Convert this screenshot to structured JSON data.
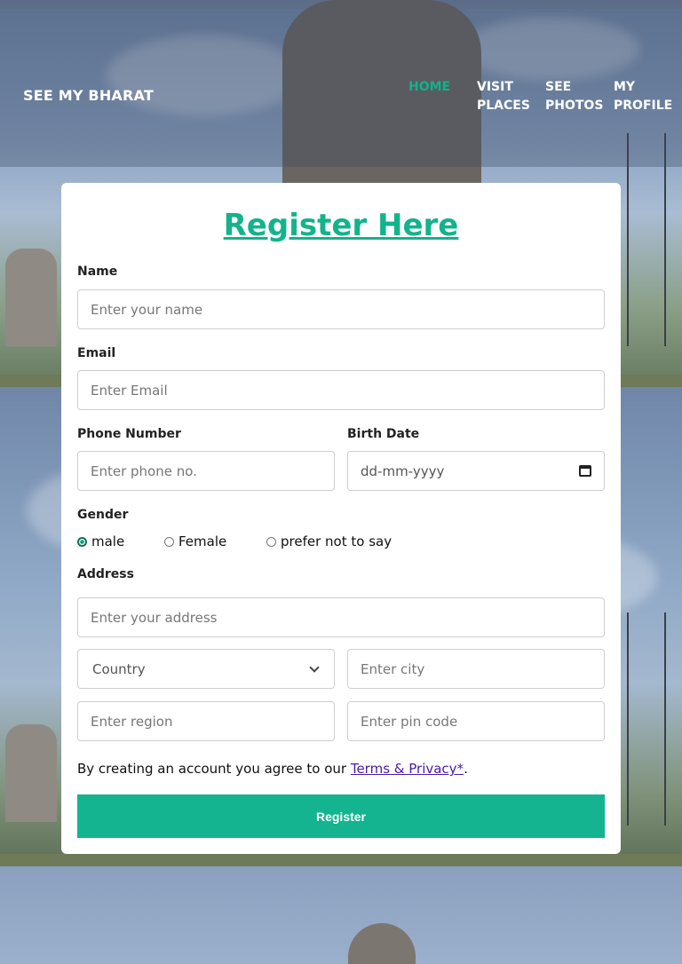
{
  "brand": "SEE MY BHARAT",
  "nav": {
    "items": [
      {
        "label": "HOME"
      },
      {
        "label": "VISIT PLACES"
      },
      {
        "label": "SEE PHOTOS"
      },
      {
        "label": "MY PROFILE"
      }
    ],
    "active_color": "#0fb38a"
  },
  "form": {
    "title": "Register Here",
    "name": {
      "label": "Name",
      "placeholder": "Enter your name"
    },
    "email": {
      "label": "Email",
      "placeholder": "Enter Email"
    },
    "phone": {
      "label": "Phone Number",
      "placeholder": "Enter phone no."
    },
    "birth": {
      "label": "Birth Date",
      "placeholder": "dd-mm-yyyy"
    },
    "gender": {
      "label": "Gender",
      "options": [
        {
          "label": "male",
          "checked": true
        },
        {
          "label": "Female",
          "checked": false
        },
        {
          "label": "prefer not to say",
          "checked": false
        }
      ]
    },
    "address": {
      "label": "Address",
      "placeholder": "Enter your address",
      "country": "Country",
      "city_placeholder": "Enter city",
      "region_placeholder": "Enter region",
      "pin_placeholder": "Enter pin code"
    },
    "terms": {
      "prefix": "By creating an account you agree to our ",
      "link": "Terms & Privacy*",
      "suffix": "."
    },
    "submit_label": "Register"
  },
  "colors": {
    "accent": "#13b48f",
    "link": "#4b1aa6"
  }
}
